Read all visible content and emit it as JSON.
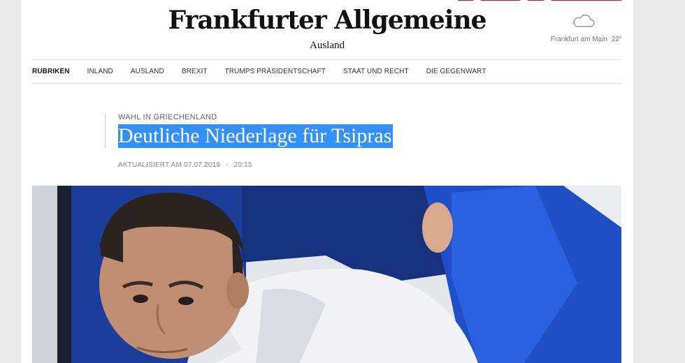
{
  "header": {
    "logo": "Frankfurter Allgemeine",
    "section": "Ausland",
    "weather": {
      "icon": "cloud-icon",
      "city": "Frankfurt am Main",
      "temperature": "22°"
    }
  },
  "nav": {
    "items": [
      "RUBRIKEN",
      "INLAND",
      "AUSLAND",
      "BREXIT",
      "TRUMPS PRÄSIDENTSCHAFT",
      "STAAT UND RECHT",
      "DIE GEGENWART"
    ]
  },
  "article": {
    "kicker": "WAHL IN GRIECHENLAND",
    "headline": "Deutliche Niederlage für Tsipras",
    "updated_label": "AKTUALISIERT AM 07.07.2019",
    "separator": "-",
    "time": "20:15"
  },
  "colors": {
    "brand_red": "#c8102e",
    "selection_blue": "#3390ff"
  }
}
